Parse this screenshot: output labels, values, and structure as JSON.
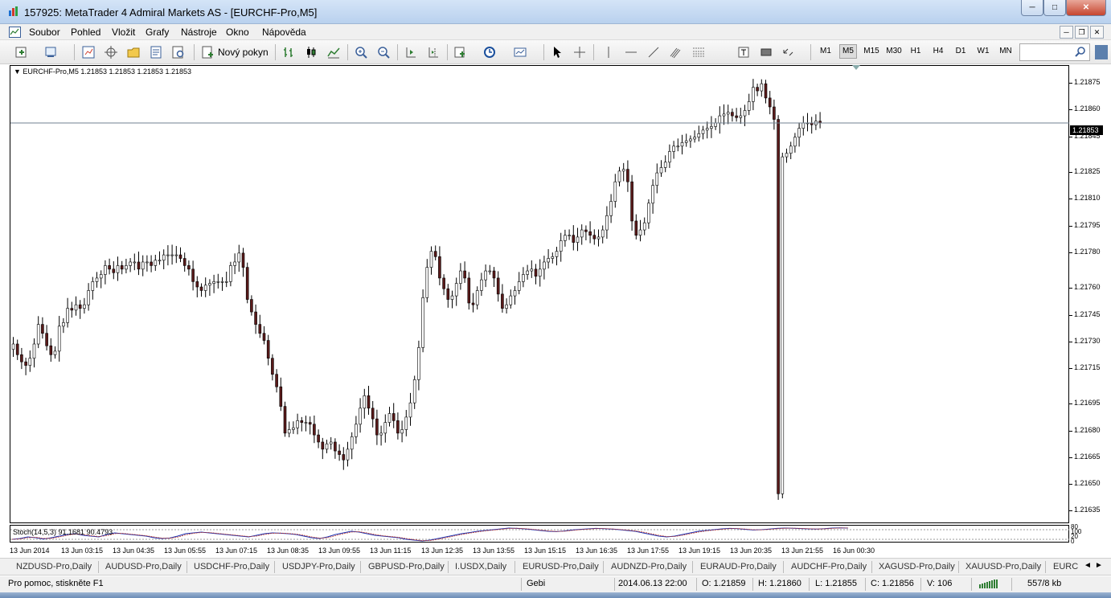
{
  "window": {
    "title": "157925: MetaTrader 4 Admiral Markets AS - [EURCHF-Pro,M5]"
  },
  "menu": [
    "Soubor",
    "Pohled",
    "Vložit",
    "Grafy",
    "Nástroje",
    "Okno",
    "Nápověda"
  ],
  "toolbar": {
    "new_order_label": "Nový pokyn",
    "timeframes": [
      "M1",
      "M5",
      "M15",
      "M30",
      "H1",
      "H4",
      "D1",
      "W1",
      "MN"
    ],
    "active_timeframe": "M5",
    "search_placeholder": ""
  },
  "chart": {
    "title": "EURCHF-Pro,M5  1.21853 1.21853 1.21853 1.21853",
    "current_price": "1.21853",
    "price_labels": [
      "1.21875",
      "1.21860",
      "1.21845",
      "1.21825",
      "1.21810",
      "1.21795",
      "1.21780",
      "1.21760",
      "1.21745",
      "1.21730",
      "1.21715",
      "1.21695",
      "1.21680",
      "1.21665",
      "1.21650",
      "1.21635"
    ],
    "time_labels": [
      "13 Jun 2014",
      "13 Jun 03:15",
      "13 Jun 04:35",
      "13 Jun 05:55",
      "13 Jun 07:15",
      "13 Jun 08:35",
      "13 Jun 09:55",
      "13 Jun 11:15",
      "13 Jun 12:35",
      "13 Jun 13:55",
      "13 Jun 15:15",
      "13 Jun 16:35",
      "13 Jun 17:55",
      "13 Jun 19:15",
      "13 Jun 20:35",
      "13 Jun 21:55",
      "16 Jun 00:30"
    ],
    "indicator": {
      "title": "Stoch(14,5,3) 91.1681 90.4793",
      "levels": [
        "80",
        "100",
        "20",
        "0"
      ]
    },
    "colors": {
      "bull": "#000000",
      "bear": "#5a1a1a",
      "line": "#000000",
      "price_line": "#708090"
    }
  },
  "chart_data": {
    "type": "candlestick",
    "ylim": [
      1.21628,
      1.21885
    ],
    "close": [
      1.21729,
      1.21723,
      1.21719,
      1.21717,
      1.21721,
      1.21729,
      1.2174,
      1.21735,
      1.21728,
      1.21723,
      1.21725,
      1.21739,
      1.21741,
      1.21749,
      1.21748,
      1.21751,
      1.21749,
      1.21751,
      1.21759,
      1.21764,
      1.21766,
      1.21768,
      1.21773,
      1.21771,
      1.21769,
      1.21773,
      1.21771,
      1.21773,
      1.21775,
      1.21775,
      1.21771,
      1.21775,
      1.21775,
      1.21773,
      1.21776,
      1.21776,
      1.21779,
      1.21779,
      1.21779,
      1.21779,
      1.21777,
      1.21773,
      1.21771,
      1.21764,
      1.21761,
      1.21759,
      1.21762,
      1.21763,
      1.21764,
      1.21764,
      1.21764,
      1.21764,
      1.21773,
      1.21775,
      1.2178,
      1.21772,
      1.21754,
      1.21747,
      1.2174,
      1.21735,
      1.21731,
      1.21721,
      1.21712,
      1.21705,
      1.21694,
      1.21679,
      1.21681,
      1.21682,
      1.21686,
      1.21685,
      1.21685,
      1.21684,
      1.21678,
      1.21674,
      1.2167,
      1.21673,
      1.21674,
      1.21669,
      1.21667,
      1.21664,
      1.2167,
      1.21677,
      1.21684,
      1.21693,
      1.217,
      1.21693,
      1.21687,
      1.21678,
      1.21679,
      1.21685,
      1.2169,
      1.21686,
      1.21679,
      1.21681,
      1.21688,
      1.21696,
      1.21709,
      1.21727,
      1.21755,
      1.21772,
      1.21781,
      1.21778,
      1.21766,
      1.2176,
      1.21754,
      1.21756,
      1.21763,
      1.2177,
      1.21766,
      1.21752,
      1.21751,
      1.21759,
      1.21765,
      1.2177,
      1.2177,
      1.21766,
      1.21757,
      1.21749,
      1.21751,
      1.21756,
      1.21759,
      1.21764,
      1.21768,
      1.2177,
      1.21771,
      1.21767,
      1.21771,
      1.21775,
      1.21777,
      1.21778,
      1.21781,
      1.21787,
      1.2179,
      1.2179,
      1.21786,
      1.21789,
      1.21793,
      1.21792,
      1.2179,
      1.21788,
      1.21789,
      1.21793,
      1.21801,
      1.21809,
      1.2182,
      1.21826,
      1.21827,
      1.2182,
      1.21798,
      1.2179,
      1.21793,
      1.21797,
      1.21808,
      1.21818,
      1.21825,
      1.21828,
      1.21831,
      1.21837,
      1.2184,
      1.2184,
      1.21842,
      1.21843,
      1.21844,
      1.21845,
      1.21847,
      1.21849,
      1.2185,
      1.21851,
      1.21853,
      1.21857,
      1.21858,
      1.21859,
      1.21857,
      1.21856,
      1.21857,
      1.2186,
      1.21865,
      1.21873,
      1.21871,
      1.21875,
      1.21867,
      1.21862,
      1.21855,
      1.21645,
      1.21834,
      1.21836,
      1.2184,
      1.21845,
      1.2185,
      1.21853,
      1.21853,
      1.21852,
      1.21854,
      1.21853
    ],
    "stoch": [
      20,
      25,
      35,
      30,
      22,
      30,
      40,
      50,
      55,
      45,
      40,
      35,
      50,
      60,
      55,
      50,
      45,
      40,
      30,
      25,
      28,
      40,
      55,
      60,
      65,
      60,
      55,
      50,
      45,
      40,
      35,
      45,
      55,
      60,
      58,
      55,
      50,
      40,
      30,
      25,
      35,
      50,
      60,
      70,
      65,
      55,
      45,
      40,
      35,
      30,
      20,
      15,
      10,
      15,
      25,
      35,
      45,
      55,
      62,
      70,
      75,
      80,
      85,
      90,
      88,
      85,
      80,
      75,
      70,
      68,
      72,
      78,
      82,
      85,
      88,
      86,
      84,
      80,
      75,
      70,
      60,
      50,
      40,
      35,
      40,
      50,
      60,
      70,
      75,
      80,
      85,
      88,
      86,
      82,
      78,
      80,
      84,
      88,
      90,
      89,
      87,
      85,
      84,
      86,
      90,
      91,
      90
    ]
  },
  "tabs": [
    "NZDUSD-Pro,Daily",
    "AUDUSD-Pro,Daily",
    "USDCHF-Pro,Daily",
    "USDJPY-Pro,Daily",
    "GBPUSD-Pro,Daily",
    "I.USDX,Daily",
    "EURUSD-Pro,Daily",
    "AUDNZD-Pro,Daily",
    "EURAUD-Pro,Daily",
    "AUDCHF-Pro,Daily",
    "XAGUSD-Pro,Daily",
    "XAUUSD-Pro,Daily",
    "EURC"
  ],
  "status": {
    "help": "Pro pomoc, stiskněte F1",
    "profile": "Gebi",
    "datetime": "2014.06.13 22:00",
    "open": "O: 1.21859",
    "high": "H: 1.21860",
    "low": "L: 1.21855",
    "close": "C: 1.21856",
    "volume": "V: 106",
    "traffic": "557/8 kb"
  }
}
